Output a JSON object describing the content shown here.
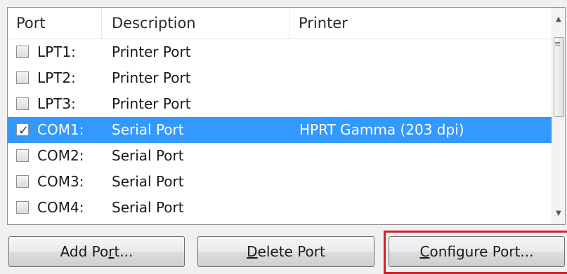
{
  "columns": {
    "port": "Port",
    "description": "Description",
    "printer": "Printer"
  },
  "ports": [
    {
      "port": "LPT1:",
      "description": "Printer Port",
      "printer": "",
      "checked": false,
      "selected": false
    },
    {
      "port": "LPT2:",
      "description": "Printer Port",
      "printer": "",
      "checked": false,
      "selected": false
    },
    {
      "port": "LPT3:",
      "description": "Printer Port",
      "printer": "",
      "checked": false,
      "selected": false
    },
    {
      "port": "COM1:",
      "description": "Serial Port",
      "printer": "HPRT Gamma (203 dpi)",
      "checked": true,
      "selected": true
    },
    {
      "port": "COM2:",
      "description": "Serial Port",
      "printer": "",
      "checked": false,
      "selected": false
    },
    {
      "port": "COM3:",
      "description": "Serial Port",
      "printer": "",
      "checked": false,
      "selected": false
    },
    {
      "port": "COM4:",
      "description": "Serial Port",
      "printer": "",
      "checked": false,
      "selected": false
    }
  ],
  "buttons": {
    "add_port": {
      "before": "Add Po",
      "mnemonic": "r",
      "after": "t..."
    },
    "delete_port": {
      "before": "",
      "mnemonic": "D",
      "after": "elete Port"
    },
    "configure_port": {
      "before": "",
      "mnemonic": "C",
      "after": "onfigure Port..."
    }
  },
  "colors": {
    "selection": "#3399ff",
    "highlight_box": "#d6212b"
  },
  "icons": {
    "checkbox_tick": "✓",
    "scroll_up": "▲",
    "scroll_down": "▼",
    "scroll_grip": "≡"
  }
}
